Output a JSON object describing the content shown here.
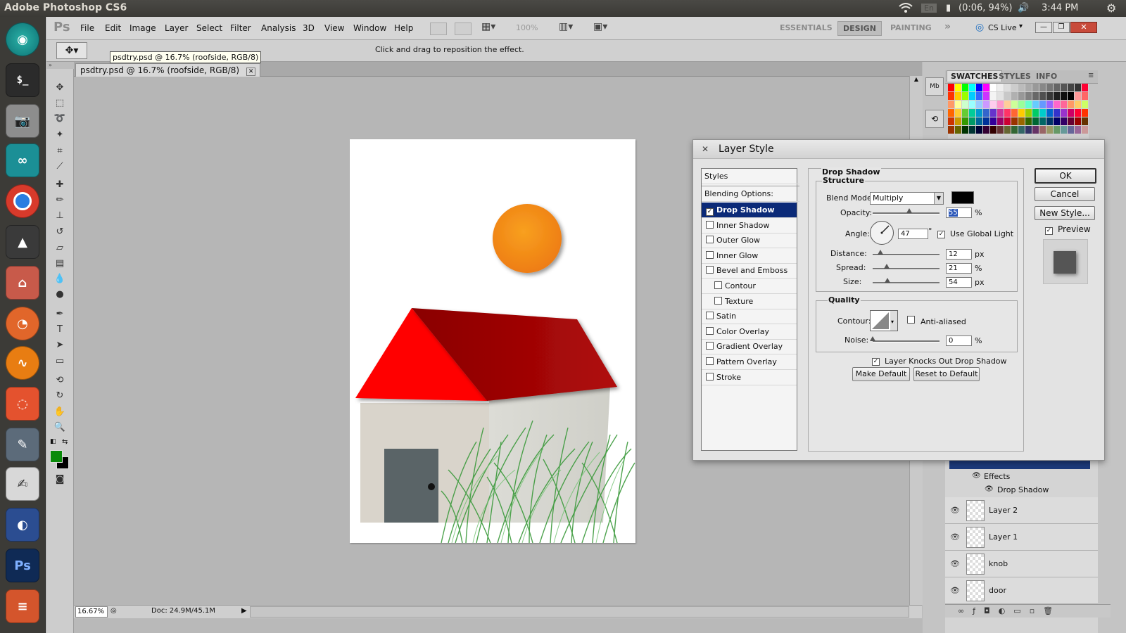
{
  "os_topbar": {
    "title": "Adobe Photoshop CS6",
    "wifi_icon": "wifi-icon",
    "lang_indicator": "En",
    "battery": "(0:06, 94%)",
    "time": "3:44 PM"
  },
  "launcher": {
    "items": [
      "ubuntu-dash",
      "terminal",
      "camera",
      "arduino",
      "chrome",
      "inkscape",
      "files",
      "firefox",
      "audio-app",
      "software-center",
      "text-editor",
      "writer",
      "eclipse",
      "photoshop",
      "stack"
    ]
  },
  "ps": {
    "logo": "Ps",
    "menu": [
      "File",
      "Edit",
      "Image",
      "Layer",
      "Select",
      "Filter",
      "Analysis",
      "3D",
      "View",
      "Window",
      "Help"
    ],
    "zoom_display": "100%",
    "workspaces": [
      "ESSENTIALS",
      "DESIGN",
      "PAINTING"
    ],
    "more_workspaces": "»",
    "cslive": "CS Live",
    "options_hint": "Click and drag to reposition the effect.",
    "tooltip": "psdtry.psd @ 16.7% (roofside, RGB/8)",
    "doc_tab": "psdtry.psd @ 16.7% (roofside, RGB/8)",
    "status_zoom": "16.67%",
    "status_doc": "Doc: 24.9M/45.1M",
    "colors": {
      "foreground": "#0a8a0a",
      "background": "#000000"
    }
  },
  "swatch_panel": {
    "tabs": [
      "SWATCHES",
      "STYLES",
      "INFO"
    ],
    "rows": [
      [
        "#ff0000",
        "#ffff00",
        "#00ff00",
        "#00ffff",
        "#0000ff",
        "#ff00ff",
        "#ffffff",
        "#eeeeee",
        "#dddddd",
        "#cccccc",
        "#bbbbbb",
        "#aaaaaa",
        "#999999",
        "#888888",
        "#777777",
        "#666666",
        "#555555",
        "#444444",
        "#333333",
        "#ff0033"
      ],
      [
        "#ff3300",
        "#ffcc00",
        "#99ff00",
        "#00ccff",
        "#3366ff",
        "#cc33ff",
        "#f4f4f4",
        "#e2e2e2",
        "#c8c8c8",
        "#b0b0b0",
        "#989898",
        "#808080",
        "#686868",
        "#505050",
        "#383838",
        "#202020",
        "#101010",
        "#000000",
        "#ff9999",
        "#ff6666"
      ],
      [
        "#ff9966",
        "#ffff99",
        "#ccffcc",
        "#99ffff",
        "#99ccff",
        "#cc99ff",
        "#ffccee",
        "#ff99cc",
        "#ffcc99",
        "#ccff99",
        "#99ff99",
        "#66ffcc",
        "#66ccff",
        "#6699ff",
        "#9966ff",
        "#ff66cc",
        "#ff6699",
        "#ff9966",
        "#ffcc66",
        "#ccff66"
      ],
      [
        "#ff6600",
        "#ffcc33",
        "#66cc33",
        "#00cc99",
        "#0099cc",
        "#3366cc",
        "#6633cc",
        "#cc3399",
        "#ff3366",
        "#ff6633",
        "#ffcc00",
        "#99cc00",
        "#00cc66",
        "#00cccc",
        "#0066cc",
        "#3333cc",
        "#9933cc",
        "#cc0066",
        "#ff0033",
        "#ff3300"
      ],
      [
        "#cc3300",
        "#cc9900",
        "#339900",
        "#009966",
        "#006699",
        "#003399",
        "#330099",
        "#990066",
        "#cc0033",
        "#993300",
        "#996600",
        "#336600",
        "#006633",
        "#006666",
        "#003366",
        "#000066",
        "#330066",
        "#660033",
        "#990000",
        "#663300"
      ],
      [
        "#993300",
        "#666600",
        "#003300",
        "#003333",
        "#000033",
        "#330033",
        "#330000",
        "#663333",
        "#666633",
        "#336633",
        "#336666",
        "#333366",
        "#663366",
        "#996666",
        "#999966",
        "#669966",
        "#669999",
        "#666699",
        "#996699",
        "#cc9999"
      ]
    ]
  },
  "layers_panel": {
    "effects_label": "Effects",
    "effect_item": "Drop Shadow",
    "layers": [
      "Layer 2",
      "Layer 1",
      "knob",
      "door"
    ]
  },
  "dialog": {
    "title": "Layer Style",
    "styles_header": "Styles",
    "blending": "Blending Options: Default",
    "style_items": [
      {
        "label": "Drop Shadow",
        "checked": true,
        "selected": true
      },
      {
        "label": "Inner Shadow",
        "checked": false
      },
      {
        "label": "Outer Glow",
        "checked": false
      },
      {
        "label": "Inner Glow",
        "checked": false
      },
      {
        "label": "Bevel and Emboss",
        "checked": false
      },
      {
        "label": "Contour",
        "checked": false
      },
      {
        "label": "Texture",
        "checked": false
      },
      {
        "label": "Satin",
        "checked": false
      },
      {
        "label": "Color Overlay",
        "checked": false
      },
      {
        "label": "Gradient Overlay",
        "checked": false
      },
      {
        "label": "Pattern Overlay",
        "checked": false
      },
      {
        "label": "Stroke",
        "checked": false
      }
    ],
    "section_title": "Drop Shadow",
    "structure": "Structure",
    "blend_mode_label": "Blend Mode:",
    "blend_mode": "Multiply",
    "shadow_color": "#000000",
    "opacity_label": "Opacity:",
    "opacity": "55",
    "angle_label": "Angle:",
    "angle": "47",
    "degree": "°",
    "use_global_light": "Use Global Light",
    "distance_label": "Distance:",
    "distance": "12",
    "spread_label": "Spread:",
    "spread": "21",
    "size_label": "Size:",
    "size": "54",
    "unit_px": "px",
    "unit_pct": "%",
    "quality": "Quality",
    "contour_label": "Contour:",
    "anti_aliased": "Anti-aliased",
    "noise_label": "Noise:",
    "noise": "0",
    "knockout": "Layer Knocks Out Drop Shadow",
    "make_default": "Make Default",
    "reset_default": "Reset to Default",
    "ok": "OK",
    "cancel": "Cancel",
    "new_style": "New Style...",
    "preview": "Preview",
    "slider_fractions": {
      "opacity": 0.55,
      "distance": 0.12,
      "spread": 0.21,
      "size": 0.22,
      "noise": 0.0
    }
  }
}
